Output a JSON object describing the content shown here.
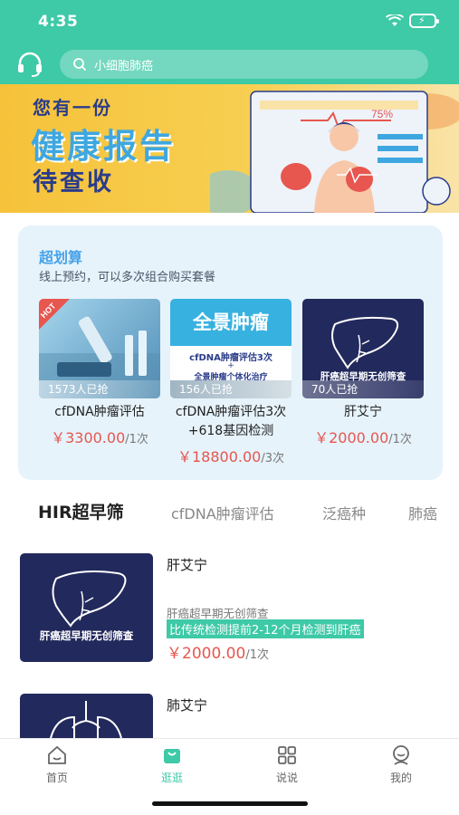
{
  "status": {
    "time": "4:35"
  },
  "header": {
    "search_placeholder": "小细胞肺癌"
  },
  "banner": {
    "line1": "您有一份",
    "line2": "健康报告",
    "line3": "待查收",
    "report_percent": "75%"
  },
  "promo": {
    "title": "超划算",
    "subtitle": "线上预约，可以多次组合购买套餐",
    "cards": [
      {
        "badge": "HOT",
        "count": "1573人已抢",
        "name": "cfDNA肿瘤评估",
        "price": "￥3300.00",
        "unit": "/1次"
      },
      {
        "image_title": "全景肿瘤",
        "image_line1": "cfDNA肿瘤评估3次",
        "image_line2": "+",
        "image_line3": "全景肿瘤个体化治疗",
        "count": "156人已抢",
        "name": "cfDNA肿瘤评估3次+618基因检测",
        "price": "￥18800.00",
        "unit": "/3次"
      },
      {
        "image_caption": "肝癌超早期无创筛查",
        "count": "70人已抢",
        "name": "肝艾宁",
        "price": "￥2000.00",
        "unit": "/1次"
      }
    ]
  },
  "tabs": [
    "HIR超早筛",
    "cfDNA肿瘤评估",
    "泛癌种",
    "肺癌"
  ],
  "products": [
    {
      "image_caption": "肝癌超早期无创筛查",
      "name": "肝艾宁",
      "desc": "肝癌超早期无创筛查",
      "highlight": "比传统检测提前2-12个月检测到肝癌",
      "price": "￥2000.00",
      "unit": "/1次"
    },
    {
      "name": "肺艾宁"
    }
  ],
  "tabbar": [
    {
      "label": "首页",
      "icon": "home-icon"
    },
    {
      "label": "逛逛",
      "icon": "shopping-bag-icon"
    },
    {
      "label": "说说",
      "icon": "grid-icon"
    },
    {
      "label": "我的",
      "icon": "profile-icon"
    }
  ],
  "colors": {
    "primary": "#3ec9a7",
    "price": "#e7564f",
    "promo_bg": "#e6f3fb",
    "thumb_bg": "#22295c"
  }
}
